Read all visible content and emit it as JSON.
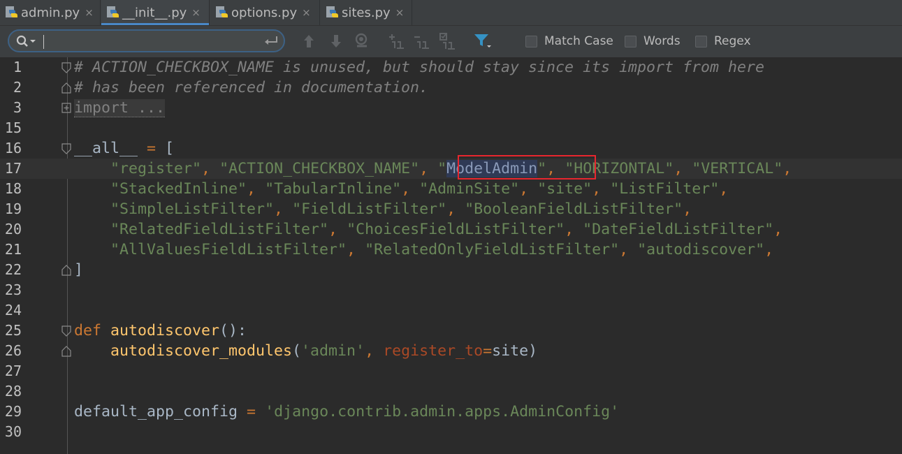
{
  "tabs": [
    {
      "label": "admin.py",
      "active": false
    },
    {
      "label": "__init__.py",
      "active": true
    },
    {
      "label": "options.py",
      "active": false
    },
    {
      "label": "sites.py",
      "active": false
    }
  ],
  "tab_close_glyph": "×",
  "search": {
    "value": "",
    "placeholder": "",
    "options": [
      {
        "label": "Match Case",
        "checked": false
      },
      {
        "label": "Words",
        "checked": false
      },
      {
        "label": "Regex",
        "checked": false
      }
    ]
  },
  "editor": {
    "highlighted_match": "ModelAdmin",
    "lines": [
      {
        "n": "1",
        "text": "# ACTION_CHECKBOX_NAME is unused, but should stay since its import from here"
      },
      {
        "n": "2",
        "text": "# has been referenced in documentation."
      },
      {
        "n": "3",
        "text": "import ..."
      },
      {
        "n": "15",
        "text": ""
      },
      {
        "n": "16",
        "text": "__all__ = ["
      },
      {
        "n": "17",
        "text": "    \"register\", \"ACTION_CHECKBOX_NAME\", \"ModelAdmin\", \"HORIZONTAL\", \"VERTICAL\","
      },
      {
        "n": "18",
        "text": "    \"StackedInline\", \"TabularInline\", \"AdminSite\", \"site\", \"ListFilter\","
      },
      {
        "n": "19",
        "text": "    \"SimpleListFilter\", \"FieldListFilter\", \"BooleanFieldListFilter\","
      },
      {
        "n": "20",
        "text": "    \"RelatedFieldListFilter\", \"ChoicesFieldListFilter\", \"DateFieldListFilter\","
      },
      {
        "n": "21",
        "text": "    \"AllValuesFieldListFilter\", \"RelatedOnlyFieldListFilter\", \"autodiscover\","
      },
      {
        "n": "22",
        "text": "]"
      },
      {
        "n": "23",
        "text": ""
      },
      {
        "n": "24",
        "text": ""
      },
      {
        "n": "25",
        "text": "def autodiscover():"
      },
      {
        "n": "26",
        "text": "    autodiscover_modules('admin', register_to=site)"
      },
      {
        "n": "27",
        "text": ""
      },
      {
        "n": "28",
        "text": ""
      },
      {
        "n": "29",
        "text": "default_app_config = 'django.contrib.admin.apps.AdminConfig'"
      },
      {
        "n": "30",
        "text": ""
      }
    ]
  },
  "colors": {
    "background": "#2b2b2b",
    "keyword": "#cc7832",
    "string": "#6a8759",
    "comment": "#808080",
    "function": "#ffc66d",
    "param": "#aa4926",
    "highlight_box": "#e8262e",
    "accent": "#4a88c7"
  },
  "icons": [
    "python-file-icon",
    "close-icon",
    "search-icon",
    "enter-icon",
    "arrow-up-icon",
    "arrow-down-icon",
    "find-usages-icon",
    "add-occurrence-icon",
    "remove-occurrence-icon",
    "select-all-occurrences-icon",
    "filter-icon",
    "fold-icon"
  ]
}
